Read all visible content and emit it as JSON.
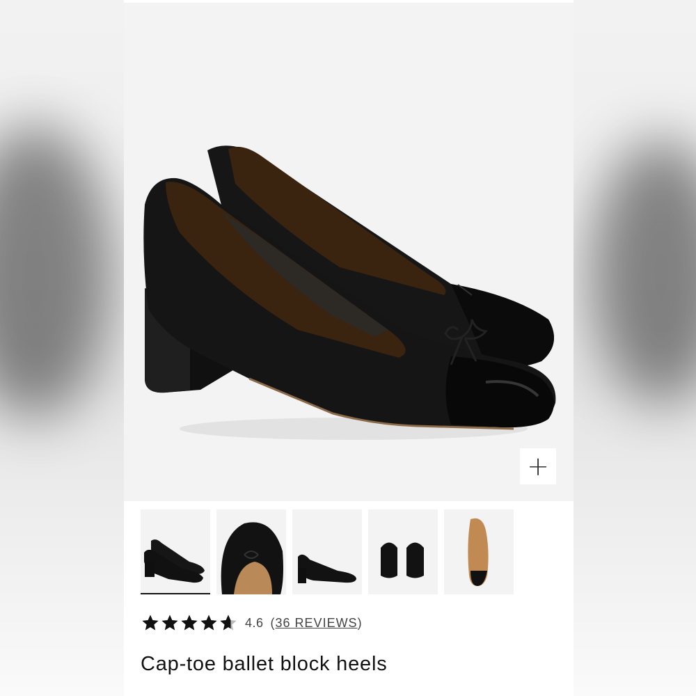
{
  "product": {
    "title": "Cap-toe ballet block heels",
    "rating_value": "4.6",
    "reviews_open": "(",
    "reviews_link": "36 REVIEWS",
    "reviews_close": ")",
    "stars": 4.6
  },
  "gallery": {
    "zoom_icon": "plus-icon",
    "thumbnails": [
      {
        "name": "thumbnail-pair-angle",
        "selected": true
      },
      {
        "name": "thumbnail-toe-closeup",
        "selected": false
      },
      {
        "name": "thumbnail-side-view",
        "selected": false
      },
      {
        "name": "thumbnail-back-view",
        "selected": false
      },
      {
        "name": "thumbnail-sole-view",
        "selected": false
      }
    ]
  },
  "colors": {
    "shoe": "#151515",
    "patent": "#0a0a0a",
    "lining": "#3a2410",
    "star": "#111111"
  }
}
